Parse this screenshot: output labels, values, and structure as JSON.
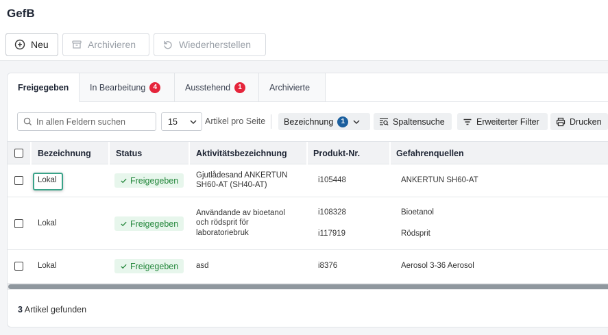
{
  "page": {
    "title": "GefB"
  },
  "toolbar": {
    "new_label": "Neu",
    "archive_label": "Archivieren",
    "restore_label": "Wiederherstellen"
  },
  "tabs": [
    {
      "label": "Freigegeben",
      "badge": ""
    },
    {
      "label": "In Bearbeitung",
      "badge": "4"
    },
    {
      "label": "Ausstehend",
      "badge": "1"
    },
    {
      "label": "Archivierte",
      "badge": ""
    }
  ],
  "controls": {
    "search_placeholder": "In allen Feldern suchen",
    "page_size": "15",
    "per_page_label": "Artikel pro Seite",
    "sort_field": "Bezeichnung",
    "sort_count": "1",
    "column_search": "Spaltensuche",
    "advanced_filter": "Erweiterter Filter",
    "print": "Drucken"
  },
  "table": {
    "columns": [
      "Bezeichnung",
      "Status",
      "Aktivitätsbezeichnung",
      "Produkt-Nr.",
      "Gefahrenquellen"
    ],
    "rows": [
      {
        "bezeichnung": "Lokal",
        "status": "Freigegeben",
        "activity": [
          "Gjutlådesand ANKERTUN",
          "SH60-AT (SH40-AT)"
        ],
        "products": [
          "i105448"
        ],
        "hazards": [
          "ANKERTUN SH60-AT"
        ]
      },
      {
        "bezeichnung": "Lokal",
        "status": "Freigegeben",
        "activity": [
          "Användande av bioetanol",
          "och rödsprit för",
          "laboratoriebruk"
        ],
        "products": [
          "i108328",
          "i117919"
        ],
        "hazards": [
          "Bioetanol",
          "Rödsprit"
        ]
      },
      {
        "bezeichnung": "Lokal",
        "status": "Freigegeben",
        "activity": [
          "asd"
        ],
        "products": [
          "i8376"
        ],
        "hazards": [
          "Aerosol 3-36 Aerosol"
        ]
      }
    ]
  },
  "footer": {
    "count": "3",
    "label": "Artikel gefunden"
  },
  "colors": {
    "accent": "#1b5f9e",
    "badge": "#e5253b",
    "status_bg": "#e7f6ec",
    "status_text": "#22863a",
    "focus": "#3aa389"
  }
}
